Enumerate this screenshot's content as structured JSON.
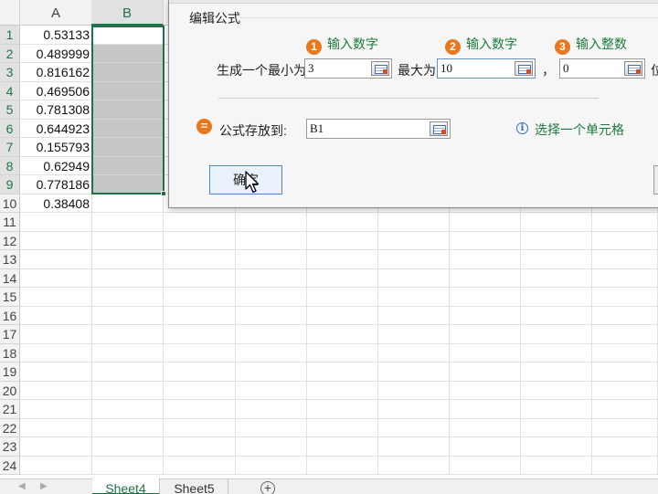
{
  "sheet": {
    "columns": [
      {
        "label": "A",
        "selected": false
      },
      {
        "label": "B",
        "selected": true
      }
    ],
    "row_labels": [
      "1",
      "2",
      "3",
      "4",
      "5",
      "6",
      "7",
      "8",
      "9",
      "10",
      "11",
      "12",
      "13",
      "14",
      "15",
      "16",
      "17",
      "18",
      "19",
      "20",
      "21",
      "22",
      "23",
      "24"
    ],
    "col_a_values": [
      "0.53133",
      "0.489999",
      "0.816162",
      "0.469506",
      "0.781308",
      "0.644923",
      "0.155793",
      "0.62949",
      "0.778186",
      "0.38408"
    ],
    "selection": "B1:B9",
    "colors": {
      "accent": "#217346",
      "selection_fill": "#c6c6c6"
    }
  },
  "tabs": {
    "items": [
      {
        "label": "Sheet4",
        "active": true
      },
      {
        "label": "Sheet5",
        "active": false
      }
    ],
    "add_icon": "plus-circle-icon"
  },
  "dialog": {
    "section_title": "编辑公式",
    "steps": [
      {
        "num": "1",
        "label": "输入数字"
      },
      {
        "num": "2",
        "label": "输入数字"
      },
      {
        "num": "3",
        "label": "输入整数"
      }
    ],
    "min_label": "生成一个最小为",
    "min_value": "3",
    "max_label": "最大为",
    "max_value": "10",
    "comma": "，",
    "decimals_value": "0",
    "decimals_label_partial": "位",
    "store_label": "公式存放到:",
    "store_value": "B1",
    "hint": "选择一个单元格",
    "ok_label": "确定",
    "colors": {
      "step_green": "#1f7a3d",
      "badge_orange": "#e9771d",
      "ok_border": "#4b87c9"
    }
  }
}
